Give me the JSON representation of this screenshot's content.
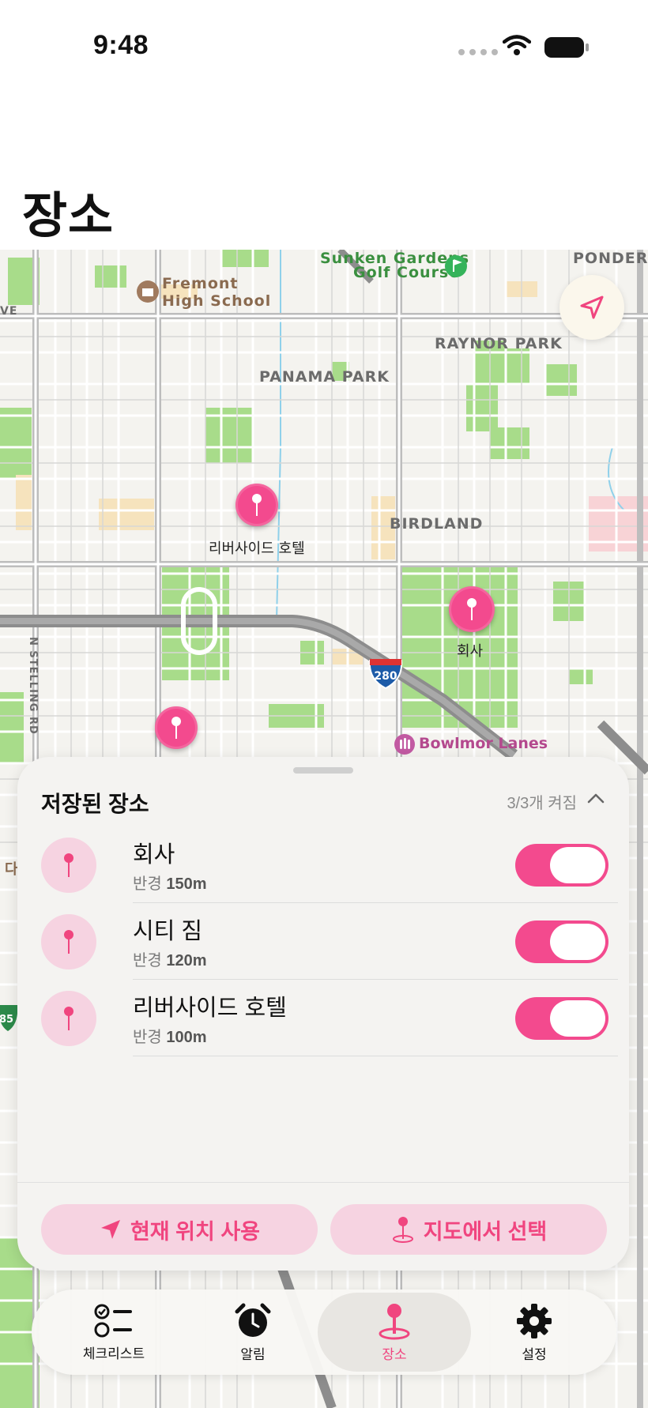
{
  "status_bar": {
    "time": "9:48"
  },
  "page_title": "장소",
  "map": {
    "labels": {
      "sunken": "Sunken Gardens",
      "golf": "Golf Course",
      "ponderosa": "PONDEROS",
      "fremont": "Fremont",
      "highschool": "High School",
      "raynor": "RAYNOR PARK",
      "panama": "PANAMA PARK",
      "birdland": "BIRDLAND",
      "stelling": "N STELLING RD",
      "bowlmor": "Bowlmor Lanes",
      "highway": "280",
      "ve": "VE",
      "edge_left": "다",
      "edge_shield": "85"
    },
    "pins": [
      {
        "label": "리버사이드 호텔"
      },
      {
        "label": "회사"
      },
      {
        "label": ""
      }
    ],
    "locate_icon": "location-arrow-icon"
  },
  "sheet": {
    "title": "저장된 장소",
    "count": "3/3개 켜짐",
    "places": [
      {
        "name": "회사",
        "radius_prefix": "반경",
        "radius_value": "150m",
        "enabled": true
      },
      {
        "name": "시티 짐",
        "radius_prefix": "반경",
        "radius_value": "120m",
        "enabled": true
      },
      {
        "name": "리버사이드 호텔",
        "radius_prefix": "반경",
        "radius_value": "100m",
        "enabled": true
      }
    ],
    "actions": {
      "current_location": "현재 위치 사용",
      "pick_on_map": "지도에서 선택"
    }
  },
  "tabbar": {
    "tabs": [
      {
        "label": "체크리스트",
        "icon": "checklist-icon"
      },
      {
        "label": "알림",
        "icon": "alarm-clock-icon"
      },
      {
        "label": "장소",
        "icon": "map-pin-icon",
        "active": true
      },
      {
        "label": "설정",
        "icon": "gear-icon"
      }
    ]
  },
  "colors": {
    "accent": "#f34a8e",
    "accent_soft": "#f6d3e1",
    "park": "#a8dc8a"
  }
}
